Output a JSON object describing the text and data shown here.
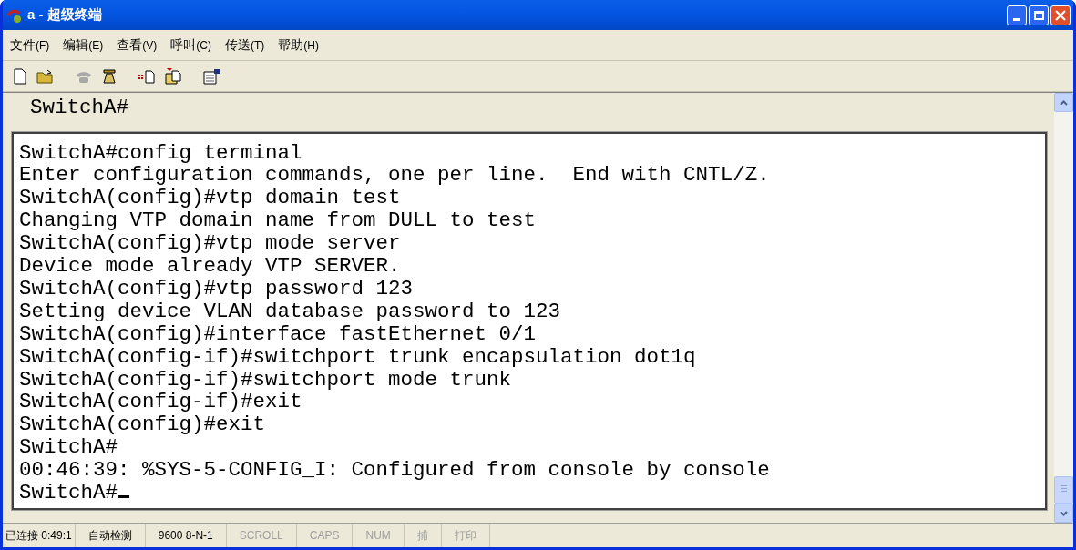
{
  "window": {
    "title_prefix": "a - ",
    "title": "超级终端"
  },
  "menu": [
    {
      "label": "文件",
      "key": "(F)"
    },
    {
      "label": "编辑",
      "key": "(E)"
    },
    {
      "label": "查看",
      "key": "(V)"
    },
    {
      "label": "呼叫",
      "key": "(C)"
    },
    {
      "label": "传送",
      "key": "(T)"
    },
    {
      "label": "帮助",
      "key": "(H)"
    }
  ],
  "toolbar": [
    {
      "kind": "new",
      "disabled": false
    },
    {
      "kind": "open",
      "disabled": false
    },
    {
      "kind": "call",
      "disabled": true
    },
    {
      "kind": "hangup",
      "disabled": false
    },
    {
      "kind": "send",
      "disabled": false
    },
    {
      "kind": "receive",
      "disabled": false
    },
    {
      "kind": "properties",
      "disabled": false
    }
  ],
  "terminal": {
    "header_line": "SwitchA#",
    "lines": [
      "SwitchA#config terminal",
      "Enter configuration commands, one per line.  End with CNTL/Z.",
      "SwitchA(config)#vtp domain test",
      "Changing VTP domain name from DULL to test",
      "SwitchA(config)#vtp mode server",
      "Device mode already VTP SERVER.",
      "SwitchA(config)#vtp password 123",
      "Setting device VLAN database password to 123",
      "SwitchA(config)#interface fastEthernet 0/1",
      "SwitchA(config-if)#switchport trunk encapsulation dot1q",
      "SwitchA(config-if)#switchport mode trunk",
      "SwitchA(config-if)#exit",
      "SwitchA(config)#exit",
      "SwitchA#",
      "00:46:39: %SYS-5-CONFIG_I: Configured from console by console",
      "SwitchA#"
    ]
  },
  "status_bar": [
    {
      "text": "已连接 0:49:1",
      "disabled": false
    },
    {
      "text": "自动检测",
      "disabled": false
    },
    {
      "text": "9600 8-N-1",
      "disabled": false
    },
    {
      "text": "SCROLL",
      "disabled": true
    },
    {
      "text": "CAPS",
      "disabled": true
    },
    {
      "text": "NUM",
      "disabled": true
    },
    {
      "text": "捕",
      "disabled": true
    },
    {
      "text": "打印",
      "disabled": true
    }
  ]
}
